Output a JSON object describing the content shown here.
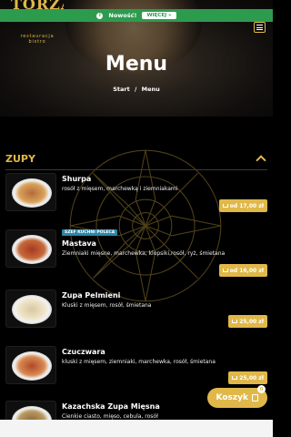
{
  "promo": {
    "text": "Nowość!",
    "button": "WIĘCEJ »"
  },
  "brand": {
    "name": "TORZA",
    "tagline": "restauracja bistro"
  },
  "hero": {
    "title": "Menu",
    "breadcrumb": [
      "Start",
      "/",
      "Menu"
    ]
  },
  "section": {
    "title": "ZUPY"
  },
  "items": [
    {
      "name": "Shurpa",
      "desc": "rosół z mięsem, marchewką i ziemniakami",
      "price": "od 17,00 zł",
      "badge": ""
    },
    {
      "name": "Mastava",
      "desc": "Ziemniaki mięsne, marchewka, klopsiki,rosół, ryż, śmietana",
      "price": "od 16,00 zł",
      "badge": "SZEF KUCHNI POLECA"
    },
    {
      "name": "Zupa Pelmieni",
      "desc": "Kluski z mięsem, rosół, śmietana",
      "price": "25,00 zł",
      "badge": ""
    },
    {
      "name": "Czuczwara",
      "desc": "kluski z mięsem, ziemniaki, marchewka, rosół, śmietana",
      "price": "25,00 zł",
      "badge": ""
    },
    {
      "name": "Kazachska Zupa Mięsna",
      "desc": "Cienkie ciasto, mięso, cebula, rosół",
      "price": "",
      "badge": ""
    }
  ],
  "cart": {
    "label": "Koszyk",
    "count": "0"
  },
  "colors": {
    "accent": "#e0b84a",
    "promo": "#2d9b4e",
    "badge": "#2e86a8"
  }
}
